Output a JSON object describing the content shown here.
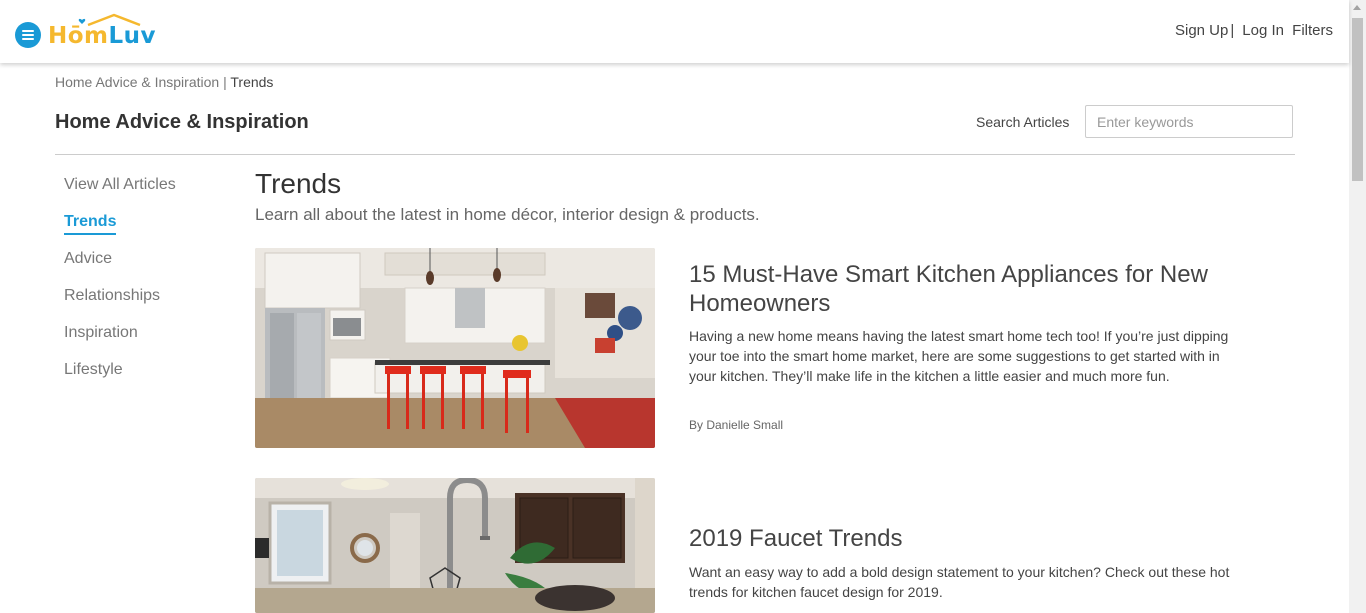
{
  "header": {
    "logo_hom": "Hōm",
    "logo_luv": "Luv",
    "signup": "Sign Up",
    "separator": "|",
    "login": "Log In",
    "filters": "Filters"
  },
  "breadcrumb": {
    "parent": "Home Advice & Inspiration",
    "separator": "|",
    "current": "Trends"
  },
  "section_title": "Home Advice & Inspiration",
  "search": {
    "label": "Search Articles",
    "placeholder": "Enter keywords"
  },
  "sidebar": {
    "items": [
      {
        "label": "View All Articles"
      },
      {
        "label": "Trends",
        "active": true
      },
      {
        "label": "Advice"
      },
      {
        "label": "Relationships"
      },
      {
        "label": "Inspiration"
      },
      {
        "label": "Lifestyle"
      }
    ]
  },
  "main": {
    "title": "Trends",
    "subtitle": "Learn all about the latest in home décor, interior design & products.",
    "articles": [
      {
        "title": "15 Must-Have Smart Kitchen Appliances for New Homeowners",
        "description": "Having a new home means having the latest smart home tech too! If you’re just dipping your toe into the smart home market, here are some suggestions to get started with in your kitchen. They’ll make life in the kitchen a little easier and much more fun.",
        "author": "By Danielle Small"
      },
      {
        "title": "2019 Faucet Trends",
        "description": "Want an easy way to add a bold design statement to your kitchen? Check out these hot trends for kitchen faucet design for 2019."
      }
    ]
  },
  "colors": {
    "accent_blue": "#1a9ad6",
    "logo_yellow": "#f5b82e"
  }
}
